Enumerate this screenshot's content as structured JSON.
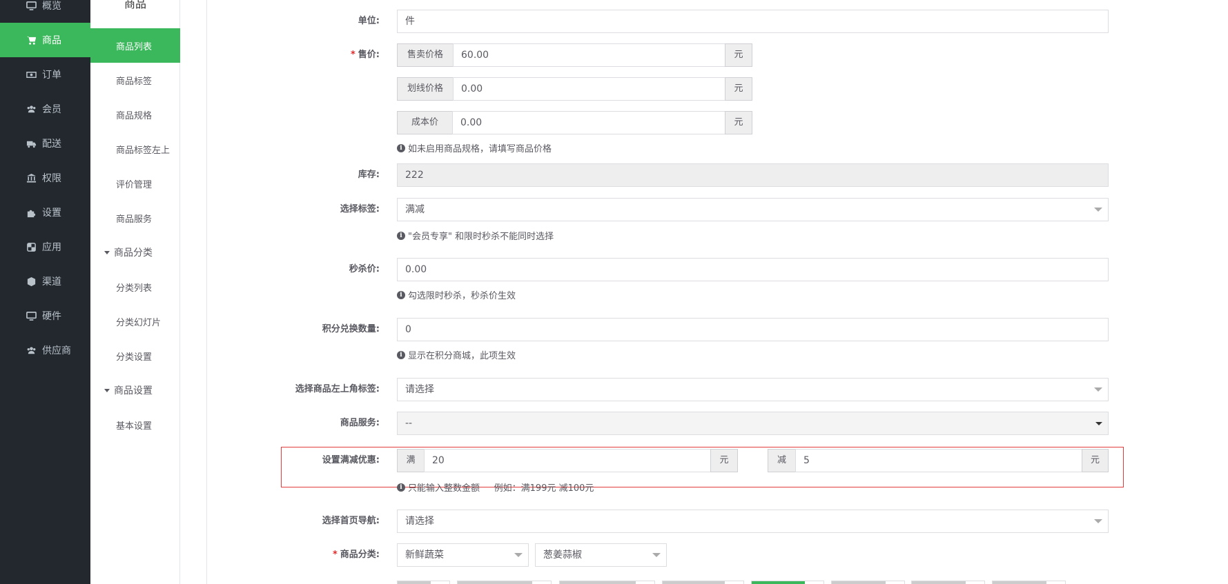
{
  "sidebar": {
    "items": [
      {
        "label": "概览",
        "icon": "monitor-icon"
      },
      {
        "label": "商品",
        "icon": "cart-icon",
        "active": true
      },
      {
        "label": "订单",
        "icon": "money-icon"
      },
      {
        "label": "会员",
        "icon": "users-icon"
      },
      {
        "label": "配送",
        "icon": "truck-icon"
      },
      {
        "label": "权限",
        "icon": "bank-icon"
      },
      {
        "label": "设置",
        "icon": "puzzle-icon"
      },
      {
        "label": "应用",
        "icon": "apps-icon"
      },
      {
        "label": "渠道",
        "icon": "cube-icon"
      },
      {
        "label": "硬件",
        "icon": "desktop-icon"
      },
      {
        "label": "供应商",
        "icon": "users-icon"
      }
    ]
  },
  "subbar": {
    "title": "商品",
    "items": {
      "list": "商品列表",
      "tags": "商品标签",
      "specs": "商品规格",
      "tag_top_left": "商品标签左上",
      "reviews": "评价管理",
      "service": "商品服务",
      "group_category": "商品分类",
      "category_list": "分类列表",
      "category_slides": "分类幻灯片",
      "category_settings": "分类设置",
      "group_settings": "商品设置",
      "basic_settings": "基本设置"
    }
  },
  "form": {
    "unit": {
      "label": "单位:",
      "value": "件"
    },
    "price": {
      "label": "售价:",
      "sale_addon": "售卖价格",
      "sale_value": "60.00",
      "sale_unit": "元",
      "strike_addon": "划线价格",
      "strike_value": "0.00",
      "strike_unit": "元",
      "cost_addon": "成本价",
      "cost_value": "0.00",
      "cost_unit": "元",
      "help": "如未启用商品规格，请填写商品价格"
    },
    "stock": {
      "label": "库存:",
      "value": "222"
    },
    "tag": {
      "label": "选择标签:",
      "value": "满减",
      "help": "\"会员专享\" 和限时秒杀不能同时选择"
    },
    "flash_price": {
      "label": "秒杀价:",
      "value": "0.00",
      "help": "勾选限时秒杀，秒杀价生效"
    },
    "points": {
      "label": "积分兑换数量:",
      "value": "0",
      "help": "显示在积分商城，此项生效"
    },
    "corner_tag": {
      "label": "选择商品左上角标签:",
      "value": "请选择"
    },
    "service": {
      "label": "商品服务:",
      "value": "--"
    },
    "discount": {
      "label": "设置满减优惠:",
      "full_addon": "满",
      "full_value": "20",
      "full_unit": "元",
      "minus_addon": "减",
      "minus_value": "5",
      "minus_unit": "元",
      "help": "只能输入整数金额     例如：满199元 减100元"
    },
    "home_nav": {
      "label": "选择首页导航:",
      "value": "请选择"
    },
    "category": {
      "label": "商品分类:",
      "value1": "新鲜蔬菜",
      "value2": "葱姜蒜椒"
    }
  },
  "colors": {
    "sidebar_bg": "#22282e",
    "accent": "#3cb85c",
    "highlight": "#e23b3b"
  }
}
